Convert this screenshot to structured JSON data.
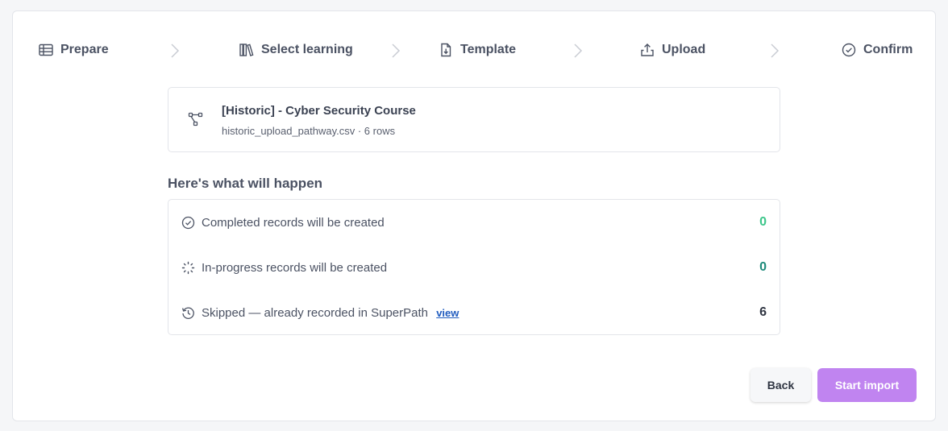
{
  "stepper": {
    "steps": [
      {
        "label": "Prepare",
        "icon": "table-icon"
      },
      {
        "label": "Select learning",
        "icon": "library-icon"
      },
      {
        "label": "Template",
        "icon": "file-download-icon"
      },
      {
        "label": "Upload",
        "icon": "upload-icon"
      },
      {
        "label": "Confirm",
        "icon": "check-circle-icon"
      }
    ]
  },
  "file": {
    "icon": "pathway-icon",
    "title": "[Historic] - Cyber Security Course",
    "meta": "historic_upload_pathway.csv · 6 rows"
  },
  "summary": {
    "title": "Here's what will happen",
    "rows": [
      {
        "icon": "check-circle-icon",
        "text": "Completed records will be created",
        "count": "0",
        "count_color": "#3cc68a"
      },
      {
        "icon": "loading-icon",
        "text": "In-progress records will be created",
        "count": "0",
        "count_color": "#1d8a7a"
      },
      {
        "icon": "history-icon",
        "text": "Skipped — already recorded in SuperPath",
        "link": "view",
        "count": "6",
        "count_color": "#2f3542"
      }
    ]
  },
  "actions": {
    "back_label": "Back",
    "start_label": "Start import"
  },
  "colors": {
    "accent": "#c084f0",
    "link": "#1f5bbf"
  }
}
